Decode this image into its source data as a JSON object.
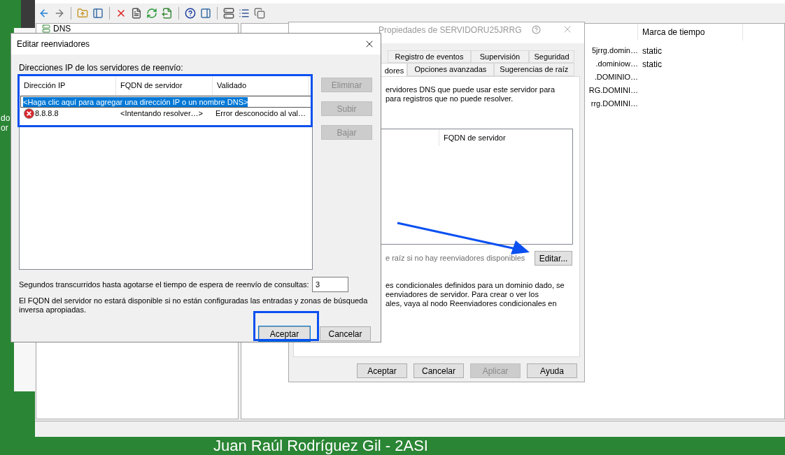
{
  "desktop": {
    "icon_label_lines": [
      "do",
      "or"
    ],
    "caption": "Juan Raúl Rodríguez Gil - 2ASI"
  },
  "console": {
    "tree": [
      {
        "label": "DNS"
      }
    ],
    "columns": [
      "Marca de tiempo"
    ],
    "rows": [
      {
        "name": "5jrrg.domin…",
        "timestamp": "static"
      },
      {
        "name": ".dominiow…",
        "timestamp": "static"
      },
      {
        "name": ".DOMINIO…"
      },
      {
        "name": "RG.DOMINI…"
      },
      {
        "name": "rrg.DOMINI…"
      }
    ]
  },
  "properties": {
    "title": "Propiedades de SERVIDORU25JRRG",
    "tabs_top": [
      {
        "label": "Registro de eventos",
        "selected": false
      },
      {
        "label": "Supervisión",
        "selected": false
      },
      {
        "label": "Seguridad",
        "selected": false
      }
    ],
    "tabs_bottom": [
      {
        "label": "dores",
        "selected": true
      },
      {
        "label": "Opciones avanzadas",
        "selected": false
      },
      {
        "label": "Sugerencias de raíz",
        "selected": false
      }
    ],
    "intro": [
      "ervidores DNS que puede usar este servidor para",
      "para registros que no puede resolver."
    ],
    "list_columns": [
      "FQDN de servidor"
    ],
    "root_hints_option": {
      "label": "e raíz si no hay reenviadores disponibles",
      "disabled": true
    },
    "edit_button": "Editar...",
    "note": [
      "es condicionales definidos para un dominio dado, se",
      "eenviadores de servidor. Para crear o ver los",
      "ales, vaya al nodo Reenviadores condicionales en"
    ],
    "buttons": [
      {
        "label": "Aceptar",
        "disabled": false
      },
      {
        "label": "Cancelar",
        "disabled": false
      },
      {
        "label": "Aplicar",
        "disabled": true
      },
      {
        "label": "Ayuda",
        "disabled": false
      }
    ]
  },
  "editor": {
    "title": "Editar reenviadores",
    "list_label": "Direcciones IP de los servidores de reenvío:",
    "columns": [
      "Dirección IP",
      "FQDN de servidor",
      "Validado"
    ],
    "new_entry": {
      "text": "<Haga clic aquí para agregar una dirección IP o un nombre DNS>",
      "selected": true
    },
    "rows": [
      {
        "kind": "error",
        "ip": "8.8.8.8",
        "fqdn": "<Intentando resolver…>",
        "validated": "Error desconocido al val…"
      }
    ],
    "side_buttons": [
      {
        "label": "Eliminar",
        "disabled": true
      },
      {
        "label": "Subir",
        "disabled": true
      },
      {
        "label": "Bajar",
        "disabled": true
      }
    ],
    "timeout_label": "Segundos transcurridos hasta agotarse el tiempo de espera de reenvío de consultas:",
    "timeout_value": "3",
    "note": "El FQDN del servidor no estará disponible si no están configuradas las entradas y zonas de búsqueda inversa apropiadas.",
    "buttons": [
      {
        "label": "Aceptar",
        "default": true
      },
      {
        "label": "Cancelar",
        "default": false
      }
    ]
  }
}
